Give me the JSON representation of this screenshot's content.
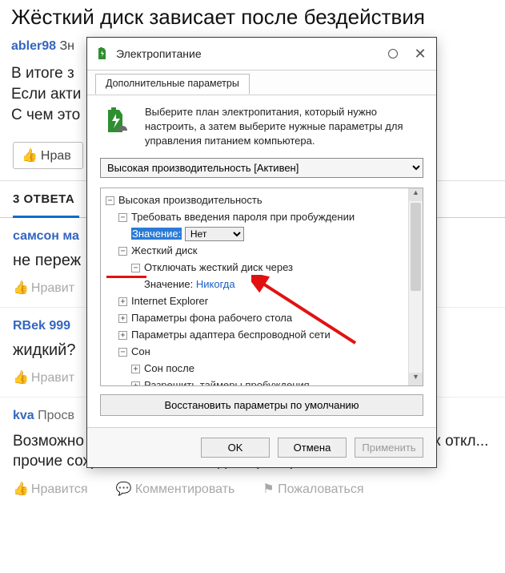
{
  "page": {
    "title": "Жёсткий диск зависает после бездействия",
    "asker_name": "abler98",
    "asker_role": "Зн",
    "body_line1": "В итоге з",
    "body_line2": "Если акти",
    "body_line3": "С чем это",
    "like_label": "Нрав"
  },
  "answers_header": "3 ОТВЕТА",
  "answers": [
    {
      "user": "самсон ма",
      "text": "не переж",
      "like": "Нравит"
    },
    {
      "user": "RBek 999",
      "text": "жидкий?",
      "like": "Нравит"
    },
    {
      "user": "kva",
      "role": "Просв",
      "text": "Возможно глючат настройки электропитания - уберите в них откл... прочие сохранялки. Хотя бы для проверки.",
      "like": "Нравится",
      "comment": "Комментировать",
      "complain": "Пожаловаться"
    }
  ],
  "dialog": {
    "title": "Электропитание",
    "tab": "Дополнительные параметры",
    "intro": "Выберите план электропитания, который нужно настроить, а затем выберите нужные параметры для управления питанием компьютера.",
    "plan_select": "Высокая производительность [Активен]",
    "tree": {
      "root": "Высокая производительность",
      "n1": "Требовать введения пароля при пробуждении",
      "n1_val_label": "Значение:",
      "n1_val": "Нет",
      "hdd": "Жесткий диск",
      "hdd_off": "Отключать жесткий диск через",
      "hdd_val_label": "Значение:",
      "hdd_val": "Никогда",
      "ie": "Internet Explorer",
      "bg": "Параметры фона рабочего стола",
      "wifi": "Параметры адаптера беспроводной сети",
      "sleep": "Сон",
      "sleep_after": "Сон после",
      "sleep_cut": "Разрешить таймеры пробуждения"
    },
    "restore": "Восстановить параметры по умолчанию",
    "ok": "OK",
    "cancel": "Отмена",
    "apply": "Применить"
  }
}
